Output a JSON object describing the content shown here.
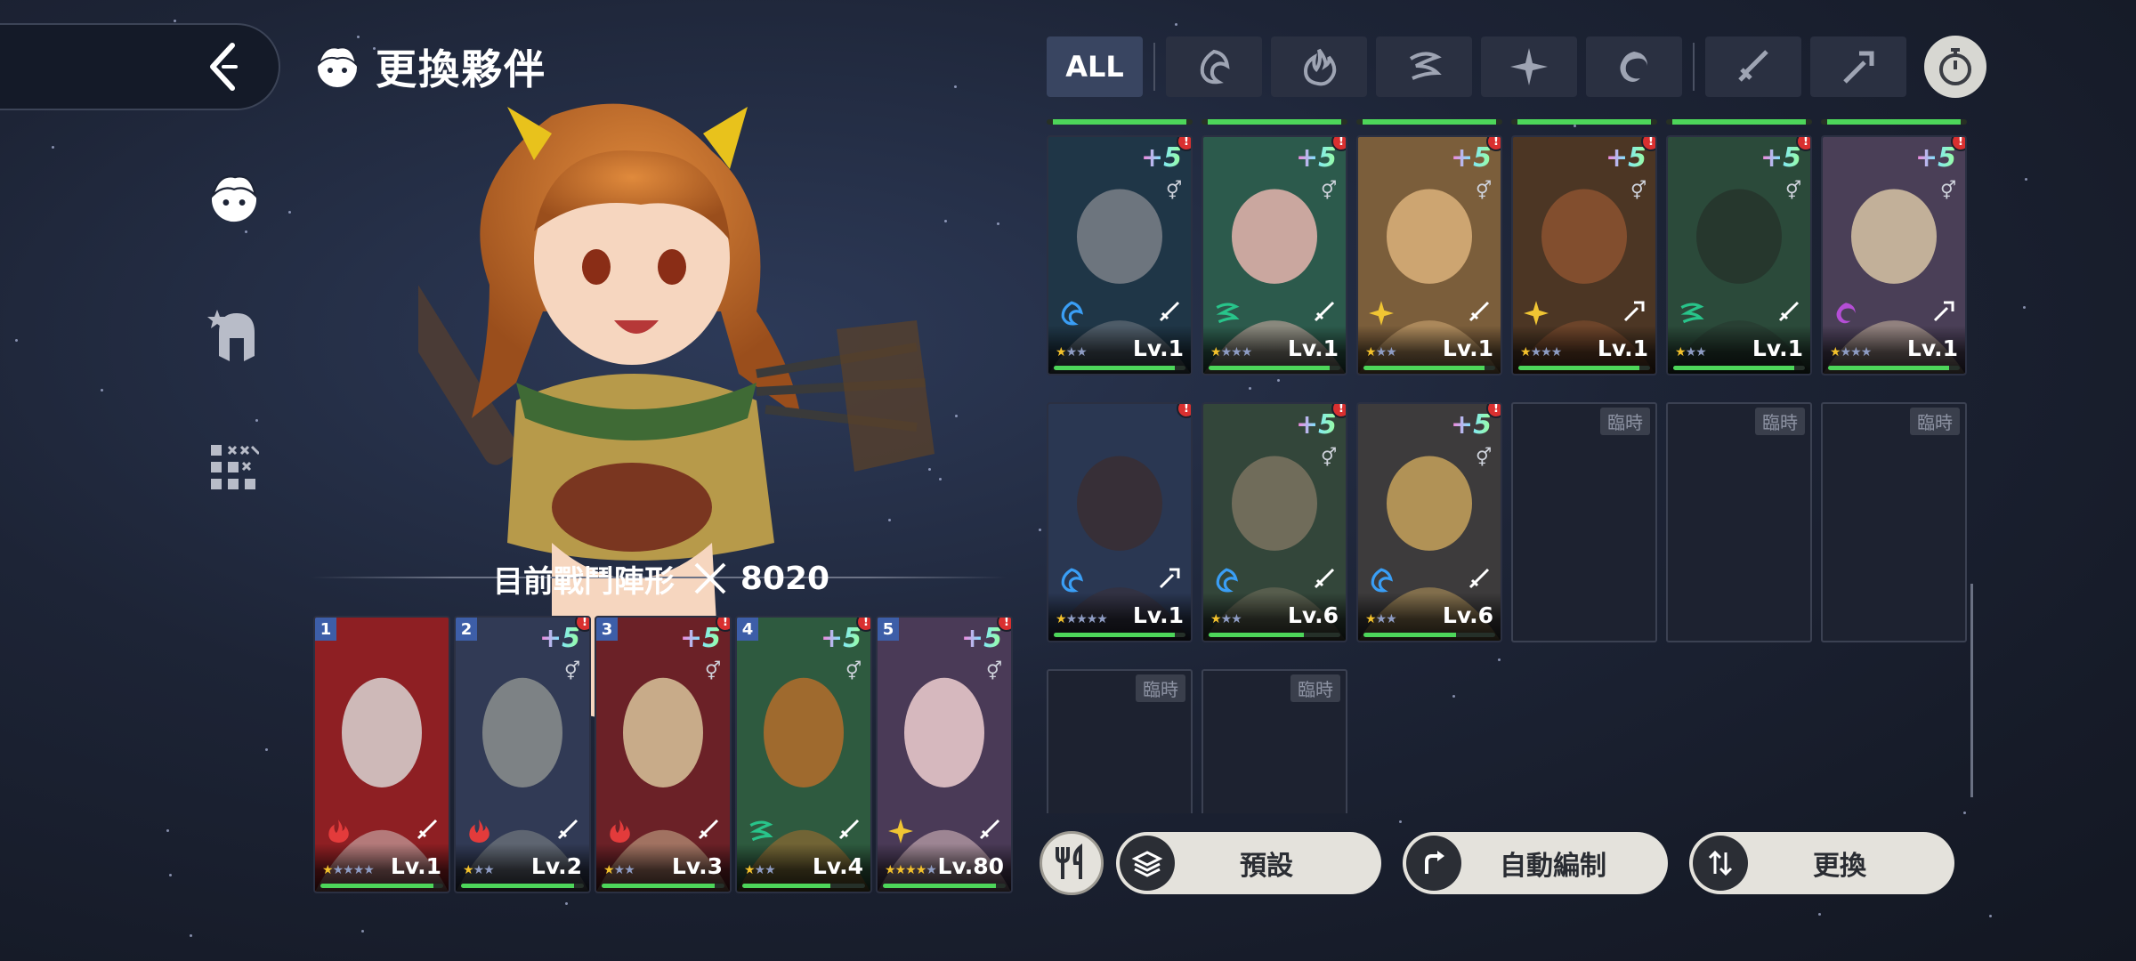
{
  "header": {
    "title": "更換夥伴",
    "back_icon": "chevron-left-icon",
    "title_icon": "hero-head-icon"
  },
  "side_nav": [
    {
      "icon": "hero-head-icon",
      "active": true
    },
    {
      "icon": "helmet-star-icon",
      "active": false
    },
    {
      "icon": "grid-formation-icon",
      "active": false
    }
  ],
  "filters": {
    "all_label": "ALL",
    "elements": [
      "water-element-icon",
      "fire-element-icon",
      "wind-element-icon",
      "light-element-icon",
      "dark-element-icon"
    ],
    "weapons": [
      "sword-icon",
      "staff-icon"
    ],
    "timer_icon": "stopwatch-icon"
  },
  "team": {
    "label": "目前戰鬥陣形",
    "power": "8020",
    "members": [
      {
        "slot": "1",
        "level": "Lv.1",
        "stars": 1,
        "max_stars": 5,
        "element": "fire",
        "plus": "",
        "alert": false,
        "hp": 0.92,
        "palette": [
          "#8e1f23",
          "#d9d5d2"
        ]
      },
      {
        "slot": "2",
        "level": "Lv.2",
        "stars": 1,
        "max_stars": 3,
        "element": "fire",
        "plus": "+5",
        "alert": true,
        "hp": 0.92,
        "palette": [
          "#313a55",
          "#8b8f8e"
        ]
      },
      {
        "slot": "3",
        "level": "Lv.3",
        "stars": 1,
        "max_stars": 3,
        "element": "fire",
        "plus": "+5",
        "alert": true,
        "hp": 0.92,
        "palette": [
          "#6b2127",
          "#d8c39b"
        ]
      },
      {
        "slot": "4",
        "level": "Lv.4",
        "stars": 1,
        "max_stars": 3,
        "element": "wind",
        "plus": "+5",
        "alert": true,
        "hp": 0.72,
        "palette": [
          "#2e5a3f",
          "#b36d2b"
        ]
      },
      {
        "slot": "5",
        "level": "Lv.80",
        "stars": 4,
        "max_stars": 5,
        "element": "light",
        "plus": "+5",
        "alert": true,
        "hp": 0.92,
        "palette": [
          "#4a3a57",
          "#efcfd0"
        ]
      }
    ]
  },
  "roster": {
    "rows": [
      [
        {
          "level": "Lv.1",
          "stars": 1,
          "max_stars": 3,
          "element": "water",
          "weapon": "sword",
          "palette": [
            "#1f3647",
            "#7b8088"
          ]
        },
        {
          "level": "Lv.1",
          "stars": 1,
          "max_stars": 4,
          "element": "wind",
          "weapon": "sword",
          "palette": [
            "#2c5a4c",
            "#e6b5ae"
          ]
        },
        {
          "level": "Lv.1",
          "stars": 1,
          "max_stars": 3,
          "element": "light",
          "weapon": "sword",
          "palette": [
            "#7b5e3b",
            "#dcb27b"
          ]
        },
        {
          "level": "Lv.1",
          "stars": 1,
          "max_stars": 4,
          "element": "light",
          "weapon": "staff",
          "palette": [
            "#4c3624",
            "#8c5230"
          ]
        },
        {
          "level": "Lv.1",
          "stars": 1,
          "max_stars": 3,
          "element": "wind",
          "weapon": "sword",
          "palette": [
            "#2b4a3a",
            "#26342c"
          ]
        },
        {
          "level": "Lv.1",
          "stars": 1,
          "max_stars": 4,
          "element": "dark",
          "weapon": "staff",
          "palette": [
            "#4a3f57",
            "#d7c4a5"
          ]
        }
      ],
      [
        {
          "level": "Lv.1",
          "stars": 1,
          "max_stars": 5,
          "element": "water",
          "weapon": "staff",
          "palette": [
            "#2a3752",
            "#3a2e33"
          ]
        },
        {
          "level": "Lv.6",
          "stars": 1,
          "max_stars": 3,
          "element": "water",
          "weapon": "sword",
          "palette": [
            "#33463a",
            "#7b7360"
          ]
        },
        {
          "level": "Lv.6",
          "stars": 1,
          "max_stars": 3,
          "element": "water",
          "weapon": "sword",
          "palette": [
            "#3d3b3c",
            "#c6a25b"
          ]
        }
      ]
    ],
    "empty_label": "臨時",
    "empty_row2_count": 3,
    "empty_row3_count": 2
  },
  "actions": {
    "food_icon": "fork-knife-icon",
    "preset_label": "預設",
    "preset_icon": "layers-icon",
    "auto_label": "自動編制",
    "auto_icon": "arrow-turn-icon",
    "swap_label": "更換",
    "swap_icon": "swap-arrows-icon"
  },
  "colors": {
    "background": "#1d2436",
    "accent_blue": "#394561",
    "hp_green": "#4dd65a",
    "alert_red": "#d93030",
    "star_gold": "#f3c12c",
    "button_bg": "#e4e2dc"
  }
}
